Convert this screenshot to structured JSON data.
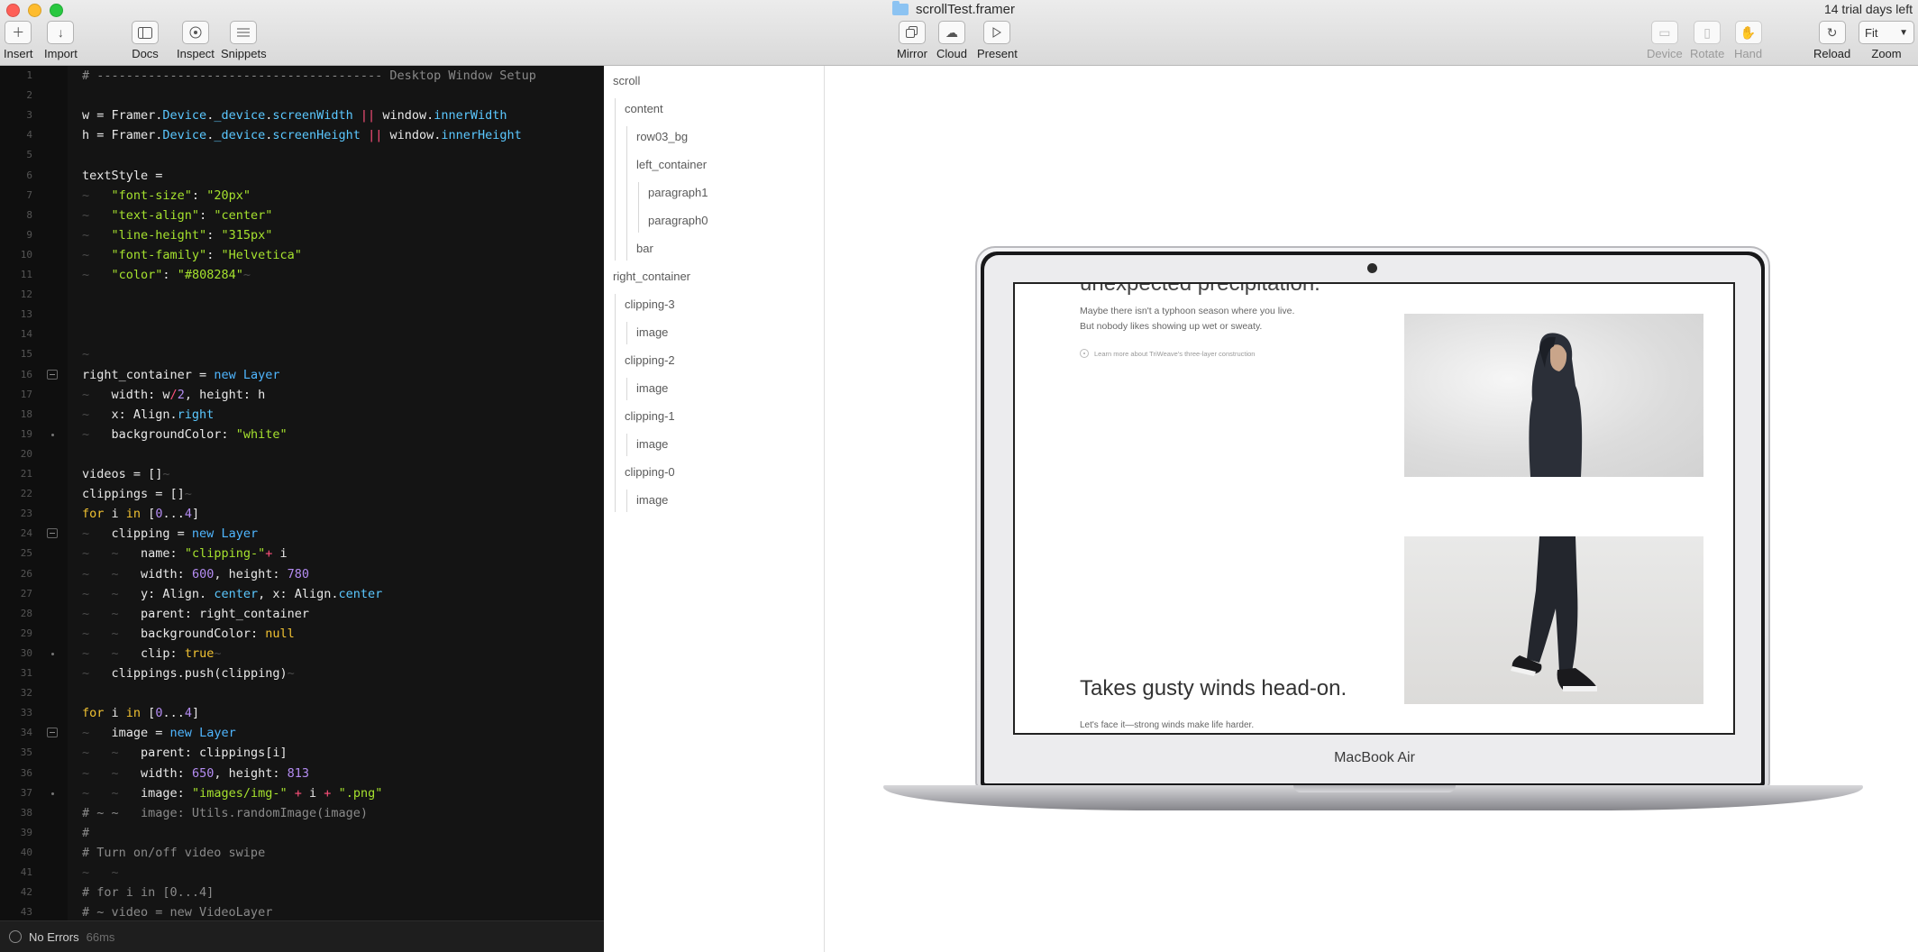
{
  "window": {
    "title": "scrollTest.framer",
    "trial_notice": "14 trial days left",
    "controls": [
      "close",
      "minimize",
      "maximize"
    ]
  },
  "toolbar": {
    "insert": "Insert",
    "import": "Import",
    "docs": "Docs",
    "inspect": "Inspect",
    "snippets": "Snippets",
    "mirror": "Mirror",
    "cloud": "Cloud",
    "present": "Present",
    "device": "Device",
    "rotate": "Rotate",
    "hand": "Hand",
    "reload": "Reload",
    "zoom_label": "Zoom",
    "zoom_value": "Fit",
    "icons": {
      "insert": "plus-icon",
      "import": "arrow-down-icon",
      "docs": "sidebar-icon",
      "inspect": "target-icon",
      "snippets": "list-icon",
      "mirror": "mirror-icon",
      "cloud": "cloud-icon",
      "present": "play-icon",
      "device": "device-icon",
      "rotate": "rotate-icon",
      "hand": "hand-icon",
      "reload": "reload-icon"
    }
  },
  "editor": {
    "lines": [
      {
        "n": 1,
        "tokens": [
          [
            "cm",
            "# --------------------------------------- Desktop Window Setup"
          ]
        ]
      },
      {
        "n": 2,
        "tokens": []
      },
      {
        "n": 3,
        "tokens": [
          [
            "",
            "w = Framer."
          ],
          [
            "pr",
            "Device"
          ],
          [
            "",
            "."
          ],
          [
            "pr",
            "_device"
          ],
          [
            "",
            "."
          ],
          [
            "pr",
            "screenWidth"
          ],
          [
            "",
            " "
          ],
          [
            "op",
            "||"
          ],
          [
            "",
            " window."
          ],
          [
            "pr",
            "innerWidth"
          ]
        ]
      },
      {
        "n": 4,
        "tokens": [
          [
            "",
            "h = Framer."
          ],
          [
            "pr",
            "Device"
          ],
          [
            "",
            "."
          ],
          [
            "pr",
            "_device"
          ],
          [
            "",
            "."
          ],
          [
            "pr",
            "screenHeight"
          ],
          [
            "",
            " "
          ],
          [
            "op",
            "||"
          ],
          [
            "",
            " window."
          ],
          [
            "pr",
            "innerHeight"
          ]
        ]
      },
      {
        "n": 5,
        "tokens": []
      },
      {
        "n": 6,
        "tokens": [
          [
            "",
            "textStyle ="
          ]
        ]
      },
      {
        "n": 7,
        "tokens": [
          [
            "ws",
            "~   "
          ],
          [
            "st",
            "\"font-size\""
          ],
          [
            "",
            ": "
          ],
          [
            "st",
            "\"20px\""
          ]
        ]
      },
      {
        "n": 8,
        "tokens": [
          [
            "ws",
            "~   "
          ],
          [
            "st",
            "\"text-align\""
          ],
          [
            "",
            ": "
          ],
          [
            "st",
            "\"center\""
          ]
        ]
      },
      {
        "n": 9,
        "tokens": [
          [
            "ws",
            "~   "
          ],
          [
            "st",
            "\"line-height\""
          ],
          [
            "",
            ": "
          ],
          [
            "st",
            "\"315px\""
          ]
        ]
      },
      {
        "n": 10,
        "tokens": [
          [
            "ws",
            "~   "
          ],
          [
            "st",
            "\"font-family\""
          ],
          [
            "",
            ": "
          ],
          [
            "st",
            "\"Helvetica\""
          ]
        ]
      },
      {
        "n": 11,
        "tokens": [
          [
            "ws",
            "~   "
          ],
          [
            "st",
            "\"color\""
          ],
          [
            "",
            ": "
          ],
          [
            "st",
            "\"#808284\""
          ],
          [
            "ws",
            "~"
          ]
        ]
      },
      {
        "n": 12,
        "tokens": []
      },
      {
        "n": 13,
        "tokens": []
      },
      {
        "n": 14,
        "tokens": []
      },
      {
        "n": 15,
        "tokens": [
          [
            "ws",
            "~"
          ]
        ]
      },
      {
        "n": 16,
        "fold": "box",
        "tokens": [
          [
            "",
            "right_container = "
          ],
          [
            "nw",
            "new"
          ],
          [
            "",
            " "
          ],
          [
            "nw",
            "Layer"
          ]
        ]
      },
      {
        "n": 17,
        "tokens": [
          [
            "ws",
            "~   "
          ],
          [
            "",
            "width: w"
          ],
          [
            "op",
            "/"
          ],
          [
            "nm",
            "2"
          ],
          [
            "",
            ", height: h"
          ]
        ]
      },
      {
        "n": 18,
        "tokens": [
          [
            "ws",
            "~   "
          ],
          [
            "",
            "x: Align."
          ],
          [
            "pr",
            "right"
          ]
        ]
      },
      {
        "n": 19,
        "fold": "dot",
        "tokens": [
          [
            "ws",
            "~   "
          ],
          [
            "",
            "backgroundColor: "
          ],
          [
            "st",
            "\"white\""
          ]
        ]
      },
      {
        "n": 20,
        "tokens": []
      },
      {
        "n": 21,
        "tokens": [
          [
            "",
            "videos = []"
          ],
          [
            "ws",
            "~"
          ]
        ]
      },
      {
        "n": 22,
        "tokens": [
          [
            "",
            "clippings = []"
          ],
          [
            "ws",
            "~"
          ]
        ]
      },
      {
        "n": 23,
        "tokens": [
          [
            "kw",
            "for"
          ],
          [
            "",
            " i "
          ],
          [
            "kw",
            "in"
          ],
          [
            "",
            " ["
          ],
          [
            "nm",
            "0"
          ],
          [
            "",
            "..."
          ],
          [
            "nm",
            "4"
          ],
          [
            "",
            "]"
          ]
        ]
      },
      {
        "n": 24,
        "fold": "box",
        "tokens": [
          [
            "ws",
            "~   "
          ],
          [
            "",
            "clipping = "
          ],
          [
            "nw",
            "new"
          ],
          [
            "",
            " "
          ],
          [
            "nw",
            "Layer"
          ]
        ]
      },
      {
        "n": 25,
        "tokens": [
          [
            "ws",
            "~   ~   "
          ],
          [
            "",
            "name: "
          ],
          [
            "st",
            "\"clipping-\""
          ],
          [
            "op",
            "+"
          ],
          [
            "",
            " i"
          ]
        ]
      },
      {
        "n": 26,
        "tokens": [
          [
            "ws",
            "~   ~   "
          ],
          [
            "",
            "width: "
          ],
          [
            "nm",
            "600"
          ],
          [
            "",
            ", height: "
          ],
          [
            "nm",
            "780"
          ]
        ]
      },
      {
        "n": 27,
        "tokens": [
          [
            "ws",
            "~   ~   "
          ],
          [
            "",
            "y: Align. "
          ],
          [
            "pr",
            "center"
          ],
          [
            "",
            ", x: Align."
          ],
          [
            "pr",
            "center"
          ]
        ]
      },
      {
        "n": 28,
        "tokens": [
          [
            "ws",
            "~   ~   "
          ],
          [
            "",
            "parent: right_container"
          ]
        ]
      },
      {
        "n": 29,
        "tokens": [
          [
            "ws",
            "~   ~   "
          ],
          [
            "",
            "backgroundColor: "
          ],
          [
            "kw",
            "null"
          ]
        ]
      },
      {
        "n": 30,
        "fold": "dot",
        "tokens": [
          [
            "ws",
            "~   ~   "
          ],
          [
            "",
            "clip: "
          ],
          [
            "kw",
            "true"
          ],
          [
            "ws",
            "~"
          ]
        ]
      },
      {
        "n": 31,
        "tokens": [
          [
            "ws",
            "~   "
          ],
          [
            "",
            "clippings.push(clipping)"
          ],
          [
            "ws",
            "~"
          ]
        ]
      },
      {
        "n": 32,
        "tokens": []
      },
      {
        "n": 33,
        "tokens": [
          [
            "kw",
            "for"
          ],
          [
            "",
            " i "
          ],
          [
            "kw",
            "in"
          ],
          [
            "",
            " ["
          ],
          [
            "nm",
            "0"
          ],
          [
            "",
            "..."
          ],
          [
            "nm",
            "4"
          ],
          [
            "",
            "]"
          ]
        ]
      },
      {
        "n": 34,
        "fold": "box",
        "tokens": [
          [
            "ws",
            "~   "
          ],
          [
            "",
            "image = "
          ],
          [
            "nw",
            "new"
          ],
          [
            "",
            " "
          ],
          [
            "nw",
            "Layer"
          ]
        ]
      },
      {
        "n": 35,
        "tokens": [
          [
            "ws",
            "~   ~   "
          ],
          [
            "",
            "parent: clippings[i]"
          ]
        ]
      },
      {
        "n": 36,
        "tokens": [
          [
            "ws",
            "~   ~   "
          ],
          [
            "",
            "width: "
          ],
          [
            "nm",
            "650"
          ],
          [
            "",
            ", height: "
          ],
          [
            "nm",
            "813"
          ]
        ]
      },
      {
        "n": 37,
        "fold": "dot",
        "tokens": [
          [
            "ws",
            "~   ~   "
          ],
          [
            "",
            "image: "
          ],
          [
            "st",
            "\"images/img-\""
          ],
          [
            "",
            " "
          ],
          [
            "op",
            "+"
          ],
          [
            "",
            " i "
          ],
          [
            "op",
            "+"
          ],
          [
            "",
            " "
          ],
          [
            "st",
            "\".png\""
          ]
        ]
      },
      {
        "n": 38,
        "tokens": [
          [
            "cm",
            "# ~ ~   image: Utils.randomImage(image)"
          ]
        ]
      },
      {
        "n": 39,
        "tokens": [
          [
            "cm",
            "#"
          ]
        ]
      },
      {
        "n": 40,
        "tokens": [
          [
            "cm",
            "# Turn on/off video swipe"
          ]
        ]
      },
      {
        "n": 41,
        "tokens": [
          [
            "ws",
            "~   ~"
          ]
        ]
      },
      {
        "n": 42,
        "tokens": [
          [
            "cm",
            "# for i in [0...4]"
          ]
        ]
      },
      {
        "n": 43,
        "tokens": [
          [
            "cm",
            "# ~ video = new VideoLayer"
          ]
        ]
      }
    ]
  },
  "status": {
    "text": "No Errors",
    "time": "66ms"
  },
  "layers": [
    {
      "name": "scroll",
      "depth": 0
    },
    {
      "name": "content",
      "depth": 1
    },
    {
      "name": "row03_bg",
      "depth": 2
    },
    {
      "name": "left_container",
      "depth": 2
    },
    {
      "name": "paragraph1",
      "depth": 3
    },
    {
      "name": "paragraph0",
      "depth": 3
    },
    {
      "name": "bar",
      "depth": 2
    },
    {
      "name": "right_container",
      "depth": 0
    },
    {
      "name": "clipping-3",
      "depth": 1
    },
    {
      "name": "image",
      "depth": 2
    },
    {
      "name": "clipping-2",
      "depth": 1
    },
    {
      "name": "image",
      "depth": 2
    },
    {
      "name": "clipping-1",
      "depth": 1
    },
    {
      "name": "image",
      "depth": 2
    },
    {
      "name": "clipping-0",
      "depth": 1
    },
    {
      "name": "image",
      "depth": 2
    }
  ],
  "preview": {
    "device_label": "MacBook Air",
    "screen": {
      "cut_heading": "unexpected precipitation.",
      "paragraph_1": "Maybe there isn't a typhoon season where you live.",
      "paragraph_2": "But nobody likes showing up wet or sweaty.",
      "link": "Learn more about TriWeave's three-layer construction",
      "headline": "Takes gusty winds head-on.",
      "subline": "Let's face it—strong winds make life harder."
    }
  }
}
